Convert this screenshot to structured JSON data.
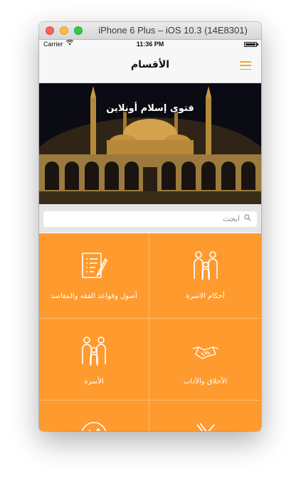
{
  "window": {
    "title": "iPhone 6 Plus – iOS 10.3 (14E8301)"
  },
  "status_bar": {
    "carrier": "Carrier",
    "time": "11:36 PM"
  },
  "nav": {
    "title": "الأقسام"
  },
  "hero": {
    "title": "فتوى إسلام أونلاين"
  },
  "search": {
    "placeholder": "ابحث"
  },
  "categories": [
    {
      "label": "أحكام الاسرة",
      "icon": "family-icon"
    },
    {
      "label": "أصول وقواعد الفقه والمقاصد",
      "icon": "document-icon"
    },
    {
      "label": "الأخلاق والآداب",
      "icon": "handshake-icon"
    },
    {
      "label": "الأسرة",
      "icon": "family-icon"
    },
    {
      "label": "",
      "icon": "fork-knife-icon"
    },
    {
      "label": "",
      "icon": "mountain-icon"
    }
  ],
  "colors": {
    "accent": "#ff9a2e",
    "hamburger": "#f5a623"
  }
}
